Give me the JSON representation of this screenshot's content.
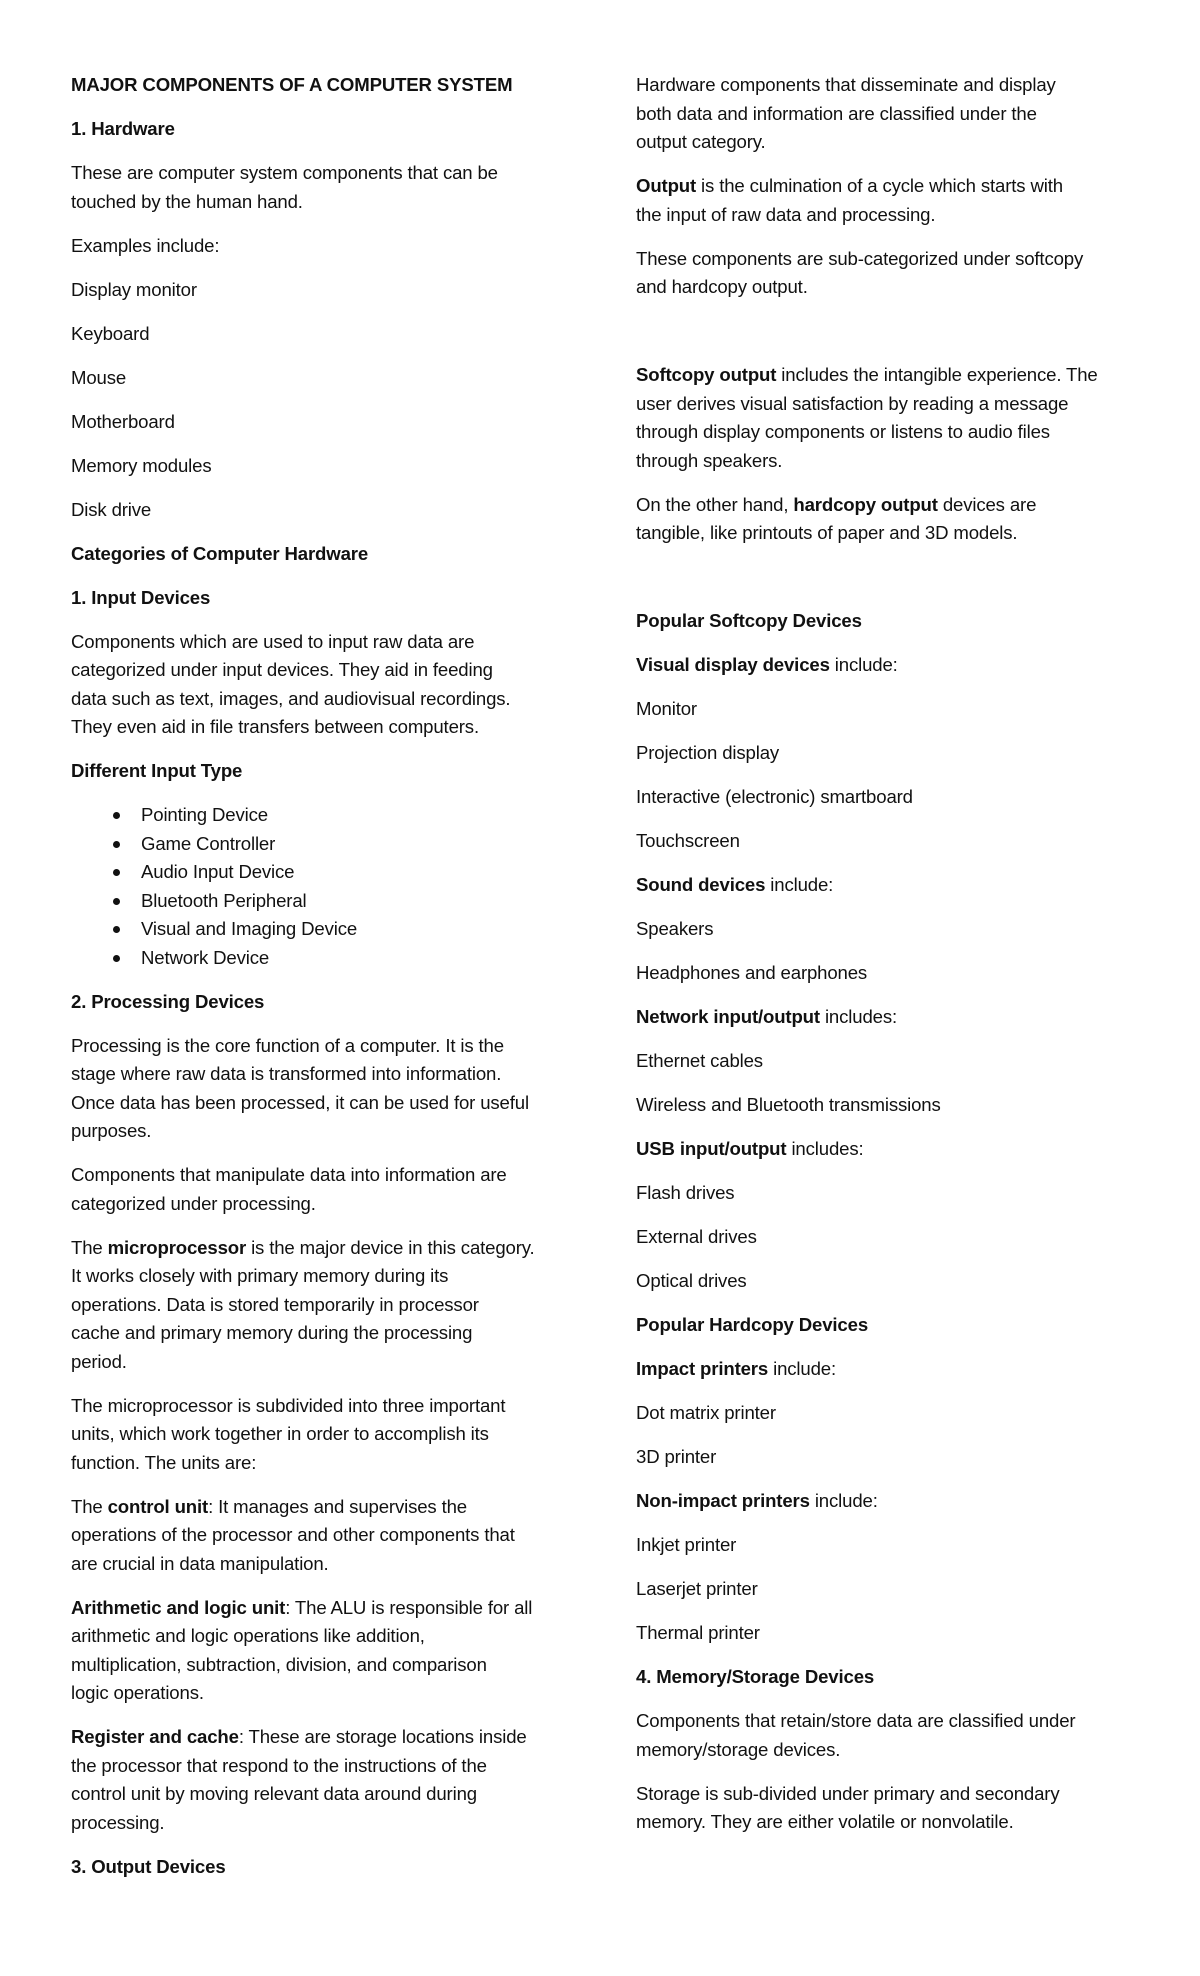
{
  "document": {
    "title": "MAJOR COMPONENTS OF A COMPUTER SYSTEM",
    "left_column": [
      {
        "type": "p",
        "name": "document-title",
        "lines": [
          [
            {
              "t": "MAJOR COMPONENTS OF A COMPUTER SYSTEM",
              "b": true
            }
          ]
        ]
      },
      {
        "type": "p",
        "name": "heading-hardware",
        "lines": [
          [
            {
              "t": "1. Hardware",
              "b": true
            }
          ]
        ]
      },
      {
        "type": "p",
        "name": "hardware-description",
        "lines": [
          [
            {
              "t": "These are computer system components that can be"
            }
          ],
          [
            {
              "t": "touched by the human hand."
            }
          ]
        ]
      },
      {
        "type": "p",
        "name": "examples-label",
        "lines": [
          [
            {
              "t": "Examples include:"
            }
          ]
        ]
      },
      {
        "type": "p",
        "name": "example-item",
        "lines": [
          [
            {
              "t": "Display monitor"
            }
          ]
        ]
      },
      {
        "type": "p",
        "name": "example-item",
        "lines": [
          [
            {
              "t": "Keyboard"
            }
          ]
        ]
      },
      {
        "type": "p",
        "name": "example-item",
        "lines": [
          [
            {
              "t": "Mouse"
            }
          ]
        ]
      },
      {
        "type": "p",
        "name": "example-item",
        "lines": [
          [
            {
              "t": "Motherboard"
            }
          ]
        ]
      },
      {
        "type": "p",
        "name": "example-item",
        "lines": [
          [
            {
              "t": "Memory modules"
            }
          ]
        ]
      },
      {
        "type": "p",
        "name": "example-item",
        "lines": [
          [
            {
              "t": "Disk drive"
            }
          ]
        ]
      },
      {
        "type": "p",
        "name": "heading-categories",
        "lines": [
          [
            {
              "t": "Categories of Computer Hardware",
              "b": true
            }
          ]
        ]
      },
      {
        "type": "p",
        "name": "heading-input-devices",
        "lines": [
          [
            {
              "t": "1. Input Devices",
              "b": true
            }
          ]
        ]
      },
      {
        "type": "p",
        "name": "input-devices-description",
        "lines": [
          [
            {
              "t": "Components which are used to input raw data are"
            }
          ],
          [
            {
              "t": "categorized under input devices. They aid in feeding"
            }
          ],
          [
            {
              "t": "data such as text, images, and audiovisual recordings."
            }
          ],
          [
            {
              "t": "They even aid in file transfers between computers."
            }
          ]
        ]
      },
      {
        "type": "p",
        "name": "heading-different-input-type",
        "lines": [
          [
            {
              "t": "Different Input Type",
              "b": true
            }
          ]
        ]
      },
      {
        "type": "bullets",
        "name": "input-type-list",
        "items": [
          "Pointing Device",
          "Game Controller",
          "Audio Input Device",
          "Bluetooth Peripheral",
          "Visual and Imaging Device",
          "Network Device"
        ]
      },
      {
        "type": "p",
        "name": "heading-processing-devices",
        "lines": [
          [
            {
              "t": "2. Processing Devices",
              "b": true
            }
          ]
        ]
      },
      {
        "type": "p",
        "name": "processing-description",
        "lines": [
          [
            {
              "t": "Processing is the core function of a computer. It is the"
            }
          ],
          [
            {
              "t": "stage where raw data is transformed into information."
            }
          ],
          [
            {
              "t": "Once data has been processed, it can be used for useful"
            }
          ],
          [
            {
              "t": "purposes."
            }
          ]
        ]
      },
      {
        "type": "p",
        "name": "processing-components",
        "lines": [
          [
            {
              "t": "Components that manipulate data into information are"
            }
          ],
          [
            {
              "t": "categorized under processing."
            }
          ]
        ]
      },
      {
        "type": "p",
        "name": "microprocessor-description",
        "lines": [
          [
            {
              "t": "The "
            },
            {
              "t": "microprocessor",
              "b": true
            },
            {
              "t": " is the major device in this category."
            }
          ],
          [
            {
              "t": "It works closely with primary memory during its"
            }
          ],
          [
            {
              "t": "operations. Data is stored temporarily in processor"
            }
          ],
          [
            {
              "t": "cache and primary memory during the processing"
            }
          ],
          [
            {
              "t": "period."
            }
          ]
        ]
      },
      {
        "type": "p",
        "name": "microprocessor-units",
        "lines": [
          [
            {
              "t": "The microprocessor is subdivided into three important"
            }
          ],
          [
            {
              "t": "units, which work together in order to accomplish its"
            }
          ],
          [
            {
              "t": "function. The units are:"
            }
          ]
        ]
      },
      {
        "type": "p",
        "name": "control-unit",
        "lines": [
          [
            {
              "t": "The "
            },
            {
              "t": "control unit",
              "b": true
            },
            {
              "t": ": It manages and supervises the"
            }
          ],
          [
            {
              "t": "operations of the processor and other components that"
            }
          ],
          [
            {
              "t": "are crucial in data manipulation."
            }
          ]
        ]
      },
      {
        "type": "p",
        "name": "alu",
        "lines": [
          [
            {
              "t": "Arithmetic and logic unit",
              "b": true
            },
            {
              "t": ": The ALU is responsible for all"
            }
          ],
          [
            {
              "t": "arithmetic and logic operations like addition,"
            }
          ],
          [
            {
              "t": "multiplication, subtraction, division, and comparison"
            }
          ],
          [
            {
              "t": "logic operations."
            }
          ]
        ]
      },
      {
        "type": "p",
        "name": "register-and-cache",
        "lines": [
          [
            {
              "t": "Register and cache",
              "b": true
            },
            {
              "t": ": These are storage locations inside"
            }
          ],
          [
            {
              "t": "the processor that respond to the instructions of the"
            }
          ],
          [
            {
              "t": "control unit by moving relevant data around during"
            }
          ],
          [
            {
              "t": "processing."
            }
          ]
        ]
      },
      {
        "type": "p",
        "name": "heading-output-devices",
        "lines": [
          [
            {
              "t": "3. Output Devices",
              "b": true
            }
          ]
        ]
      }
    ],
    "right_column": [
      {
        "type": "p",
        "name": "output-description",
        "lines": [
          [
            {
              "t": "Hardware components that disseminate and display"
            }
          ],
          [
            {
              "t": "both data and information are classified under the"
            }
          ],
          [
            {
              "t": "output category."
            }
          ]
        ]
      },
      {
        "type": "p",
        "name": "output-definition",
        "lines": [
          [
            {
              "t": "Output",
              "b": true
            },
            {
              "t": " is the culmination of a cycle which starts with"
            }
          ],
          [
            {
              "t": "the input of raw data and processing."
            }
          ]
        ]
      },
      {
        "type": "p",
        "name": "output-subcategories",
        "lines": [
          [
            {
              "t": "These components are sub-categorized under softcopy"
            }
          ],
          [
            {
              "t": "and hardcopy output."
            }
          ]
        ]
      },
      {
        "type": "blank"
      },
      {
        "type": "p",
        "name": "softcopy-output",
        "lines": [
          [
            {
              "t": "Softcopy output",
              "b": true
            },
            {
              "t": " includes the intangible experience. The"
            }
          ],
          [
            {
              "t": "user derives visual satisfaction by reading a message"
            }
          ],
          [
            {
              "t": "through display components or listens to audio files"
            }
          ],
          [
            {
              "t": "through speakers."
            }
          ]
        ]
      },
      {
        "type": "p",
        "name": "hardcopy-output",
        "lines": [
          [
            {
              "t": "On the other hand, "
            },
            {
              "t": "hardcopy output",
              "b": true
            },
            {
              "t": " devices are"
            }
          ],
          [
            {
              "t": "tangible, like printouts of paper and 3D models."
            }
          ]
        ]
      },
      {
        "type": "blank"
      },
      {
        "type": "p",
        "name": "heading-popular-softcopy",
        "lines": [
          [
            {
              "t": "Popular Softcopy Devices",
              "b": true
            }
          ]
        ]
      },
      {
        "type": "p",
        "name": "visual-display-label",
        "lines": [
          [
            {
              "t": "Visual display devices",
              "b": true
            },
            {
              "t": " include:"
            }
          ]
        ]
      },
      {
        "type": "p",
        "name": "device-item",
        "lines": [
          [
            {
              "t": "Monitor"
            }
          ]
        ]
      },
      {
        "type": "p",
        "name": "device-item",
        "lines": [
          [
            {
              "t": "Projection display"
            }
          ]
        ]
      },
      {
        "type": "p",
        "name": "device-item",
        "lines": [
          [
            {
              "t": "Interactive (electronic) smartboard"
            }
          ]
        ]
      },
      {
        "type": "p",
        "name": "device-item",
        "lines": [
          [
            {
              "t": "Touchscreen"
            }
          ]
        ]
      },
      {
        "type": "p",
        "name": "sound-devices-label",
        "lines": [
          [
            {
              "t": "Sound devices",
              "b": true
            },
            {
              "t": " include:"
            }
          ]
        ]
      },
      {
        "type": "p",
        "name": "device-item",
        "lines": [
          [
            {
              "t": "Speakers"
            }
          ]
        ]
      },
      {
        "type": "p",
        "name": "device-item",
        "lines": [
          [
            {
              "t": "Headphones and earphones"
            }
          ]
        ]
      },
      {
        "type": "p",
        "name": "network-io-label",
        "lines": [
          [
            {
              "t": "Network input/output",
              "b": true
            },
            {
              "t": " includes:"
            }
          ]
        ]
      },
      {
        "type": "p",
        "name": "device-item",
        "lines": [
          [
            {
              "t": "Ethernet cables"
            }
          ]
        ]
      },
      {
        "type": "p",
        "name": "device-item",
        "lines": [
          [
            {
              "t": "Wireless and Bluetooth transmissions"
            }
          ]
        ]
      },
      {
        "type": "p",
        "name": "usb-io-label",
        "lines": [
          [
            {
              "t": "USB input/output",
              "b": true
            },
            {
              "t": " includes:"
            }
          ]
        ]
      },
      {
        "type": "p",
        "name": "device-item",
        "lines": [
          [
            {
              "t": "Flash drives"
            }
          ]
        ]
      },
      {
        "type": "p",
        "name": "device-item",
        "lines": [
          [
            {
              "t": "External drives"
            }
          ]
        ]
      },
      {
        "type": "p",
        "name": "device-item",
        "lines": [
          [
            {
              "t": "Optical drives"
            }
          ]
        ]
      },
      {
        "type": "p",
        "name": "heading-popular-hardcopy",
        "lines": [
          [
            {
              "t": "Popular Hardcopy Devices",
              "b": true
            }
          ]
        ]
      },
      {
        "type": "p",
        "name": "impact-printers-label",
        "lines": [
          [
            {
              "t": "Impact printers",
              "b": true
            },
            {
              "t": " include:"
            }
          ]
        ]
      },
      {
        "type": "p",
        "name": "device-item",
        "lines": [
          [
            {
              "t": "Dot matrix printer"
            }
          ]
        ]
      },
      {
        "type": "p",
        "name": "device-item",
        "lines": [
          [
            {
              "t": "3D printer"
            }
          ]
        ]
      },
      {
        "type": "p",
        "name": "non-impact-printers-label",
        "lines": [
          [
            {
              "t": "Non-impact printers",
              "b": true
            },
            {
              "t": " include:"
            }
          ]
        ]
      },
      {
        "type": "p",
        "name": "device-item",
        "lines": [
          [
            {
              "t": "Inkjet printer"
            }
          ]
        ]
      },
      {
        "type": "p",
        "name": "device-item",
        "lines": [
          [
            {
              "t": "Laserjet printer"
            }
          ]
        ]
      },
      {
        "type": "p",
        "name": "device-item",
        "lines": [
          [
            {
              "t": "Thermal printer"
            }
          ]
        ]
      },
      {
        "type": "p",
        "name": "heading-memory-storage",
        "lines": [
          [
            {
              "t": "4. Memory/Storage Devices",
              "b": true
            }
          ]
        ]
      },
      {
        "type": "p",
        "name": "memory-description",
        "lines": [
          [
            {
              "t": "Components that retain/store data are classified under"
            }
          ],
          [
            {
              "t": "memory/storage devices."
            }
          ]
        ]
      },
      {
        "type": "p",
        "name": "storage-description",
        "lines": [
          [
            {
              "t": "Storage is sub-divided under primary and secondary"
            }
          ],
          [
            {
              "t": "memory. They are either volatile or nonvolatile."
            }
          ]
        ]
      }
    ]
  }
}
